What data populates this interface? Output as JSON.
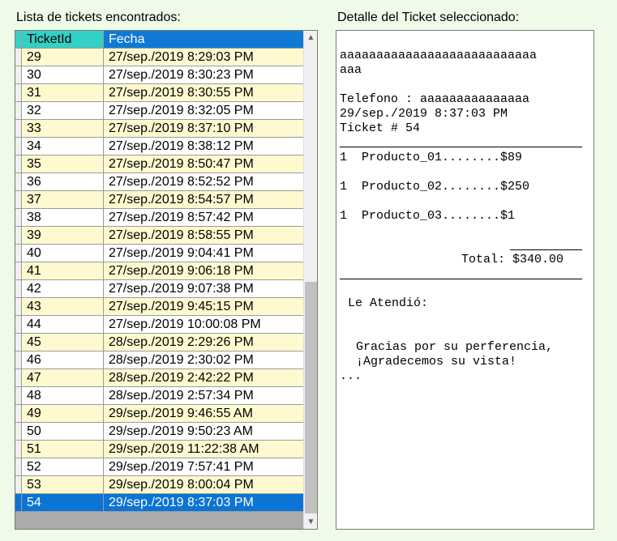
{
  "left_heading": "Lista de tickets encontrados:",
  "right_heading": "Detalle del Ticket seleccionado:",
  "grid": {
    "columns": [
      "TicketId",
      "Fecha"
    ],
    "selected_id": "54",
    "rows": [
      {
        "id": "29",
        "fecha": "27/sep./2019 8:29:03 PM"
      },
      {
        "id": "30",
        "fecha": "27/sep./2019 8:30:23 PM"
      },
      {
        "id": "31",
        "fecha": "27/sep./2019 8:30:55 PM"
      },
      {
        "id": "32",
        "fecha": "27/sep./2019 8:32:05 PM"
      },
      {
        "id": "33",
        "fecha": "27/sep./2019 8:37:10 PM"
      },
      {
        "id": "34",
        "fecha": "27/sep./2019 8:38:12 PM"
      },
      {
        "id": "35",
        "fecha": "27/sep./2019 8:50:47 PM"
      },
      {
        "id": "36",
        "fecha": "27/sep./2019 8:52:52 PM"
      },
      {
        "id": "37",
        "fecha": "27/sep./2019 8:54:57 PM"
      },
      {
        "id": "38",
        "fecha": "27/sep./2019 8:57:42 PM"
      },
      {
        "id": "39",
        "fecha": "27/sep./2019 8:58:55 PM"
      },
      {
        "id": "40",
        "fecha": "27/sep./2019 9:04:41 PM"
      },
      {
        "id": "41",
        "fecha": "27/sep./2019 9:06:18 PM"
      },
      {
        "id": "42",
        "fecha": "27/sep./2019 9:07:38 PM"
      },
      {
        "id": "43",
        "fecha": "27/sep./2019 9:45:15 PM"
      },
      {
        "id": "44",
        "fecha": "27/sep./2019 10:00:08 PM"
      },
      {
        "id": "45",
        "fecha": "28/sep./2019 2:29:26 PM"
      },
      {
        "id": "46",
        "fecha": "28/sep./2019 2:30:02 PM"
      },
      {
        "id": "47",
        "fecha": "28/sep./2019 2:42:22 PM"
      },
      {
        "id": "48",
        "fecha": "28/sep./2019 2:57:34 PM"
      },
      {
        "id": "49",
        "fecha": "29/sep./2019 9:46:55 AM"
      },
      {
        "id": "50",
        "fecha": "29/sep./2019 9:50:23 AM"
      },
      {
        "id": "51",
        "fecha": "29/sep./2019 11:22:38 AM"
      },
      {
        "id": "52",
        "fecha": "29/sep./2019 7:57:41 PM"
      },
      {
        "id": "53",
        "fecha": "29/sep./2019 8:00:04 PM"
      },
      {
        "id": "54",
        "fecha": "29/sep./2019 8:37:03 PM"
      }
    ]
  },
  "ticket": {
    "name_line1": "aaaaaaaaaaaaaaaaaaaaaaaaaaa",
    "name_line2": "aaa",
    "telefono": "Telefono : aaaaaaaaaaaaaaa",
    "fecha": "29/sep./2019 8:37:03 PM",
    "numero": "Ticket # 54",
    "items": [
      "1  Producto_01........$89",
      "1  Producto_02........$250",
      "1  Producto_03........$1"
    ],
    "total": "Total: $340.00",
    "atendio": "Le Atendió:",
    "gracias1": "Gracias por su perferencia,",
    "gracias2": "¡Agradecemos su vista!",
    "ellipsis": "..."
  },
  "icons": {
    "scroll_up": "chevron-up-icon",
    "scroll_down": "chevron-down-icon"
  },
  "colors": {
    "header_id": "#33d0c6",
    "header_fecha": "#0f7ad6",
    "row_alt": "#fff9d0",
    "selected": "#0b74d4",
    "background": "#eefbe9"
  }
}
